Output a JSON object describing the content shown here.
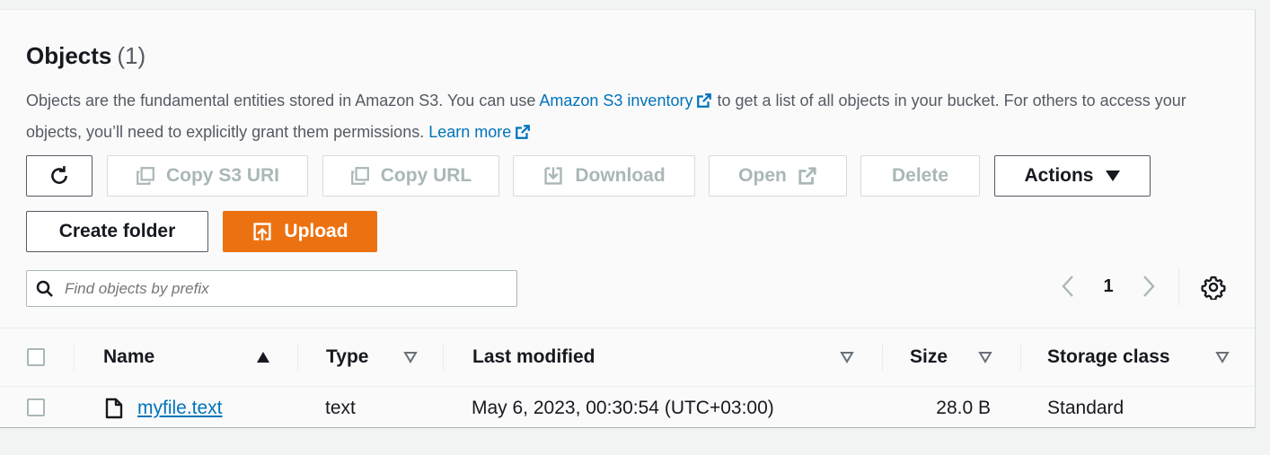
{
  "header": {
    "title": "Objects",
    "count": "(1)"
  },
  "description": {
    "part1": "Objects are the fundamental entities stored in Amazon S3. You can use ",
    "inventory_link": "Amazon S3 inventory",
    "part2": " to get a list of all objects in your bucket. For others to access your objects, you’ll need to explicitly grant them permissions. ",
    "learn_more_link": "Learn more"
  },
  "toolbar": {
    "copy_s3_uri": "Copy S3 URI",
    "copy_url": "Copy URL",
    "download": "Download",
    "open": "Open",
    "delete": "Delete",
    "actions": "Actions",
    "create_folder": "Create folder",
    "upload": "Upload"
  },
  "search": {
    "placeholder": "Find objects by prefix",
    "value": ""
  },
  "pagination": {
    "current_page": "1"
  },
  "table": {
    "columns": {
      "name": "Name",
      "type": "Type",
      "last_modified": "Last modified",
      "size": "Size",
      "storage_class": "Storage class"
    },
    "rows": [
      {
        "name": "myfile.text",
        "type": "text",
        "last_modified": "May 6, 2023, 00:30:54 (UTC+03:00)",
        "size": "28.0 B",
        "storage_class": "Standard"
      }
    ]
  },
  "colors": {
    "primary": "#ec7211",
    "link": "#0073bb",
    "text": "#16191f",
    "secondary_text": "#545b64",
    "disabled": "#aab7b8"
  },
  "icons": {
    "refresh": "refresh-icon",
    "copy": "copy-icon",
    "download": "download-icon",
    "external": "external-link-icon",
    "caret_down": "caret-down-icon",
    "upload": "upload-icon",
    "search": "search-icon",
    "chevron_left": "chevron-left-icon",
    "chevron_right": "chevron-right-icon",
    "settings": "gear-icon",
    "sort_asc": "sort-ascending-icon",
    "sort": "sort-icon",
    "file": "file-icon"
  }
}
